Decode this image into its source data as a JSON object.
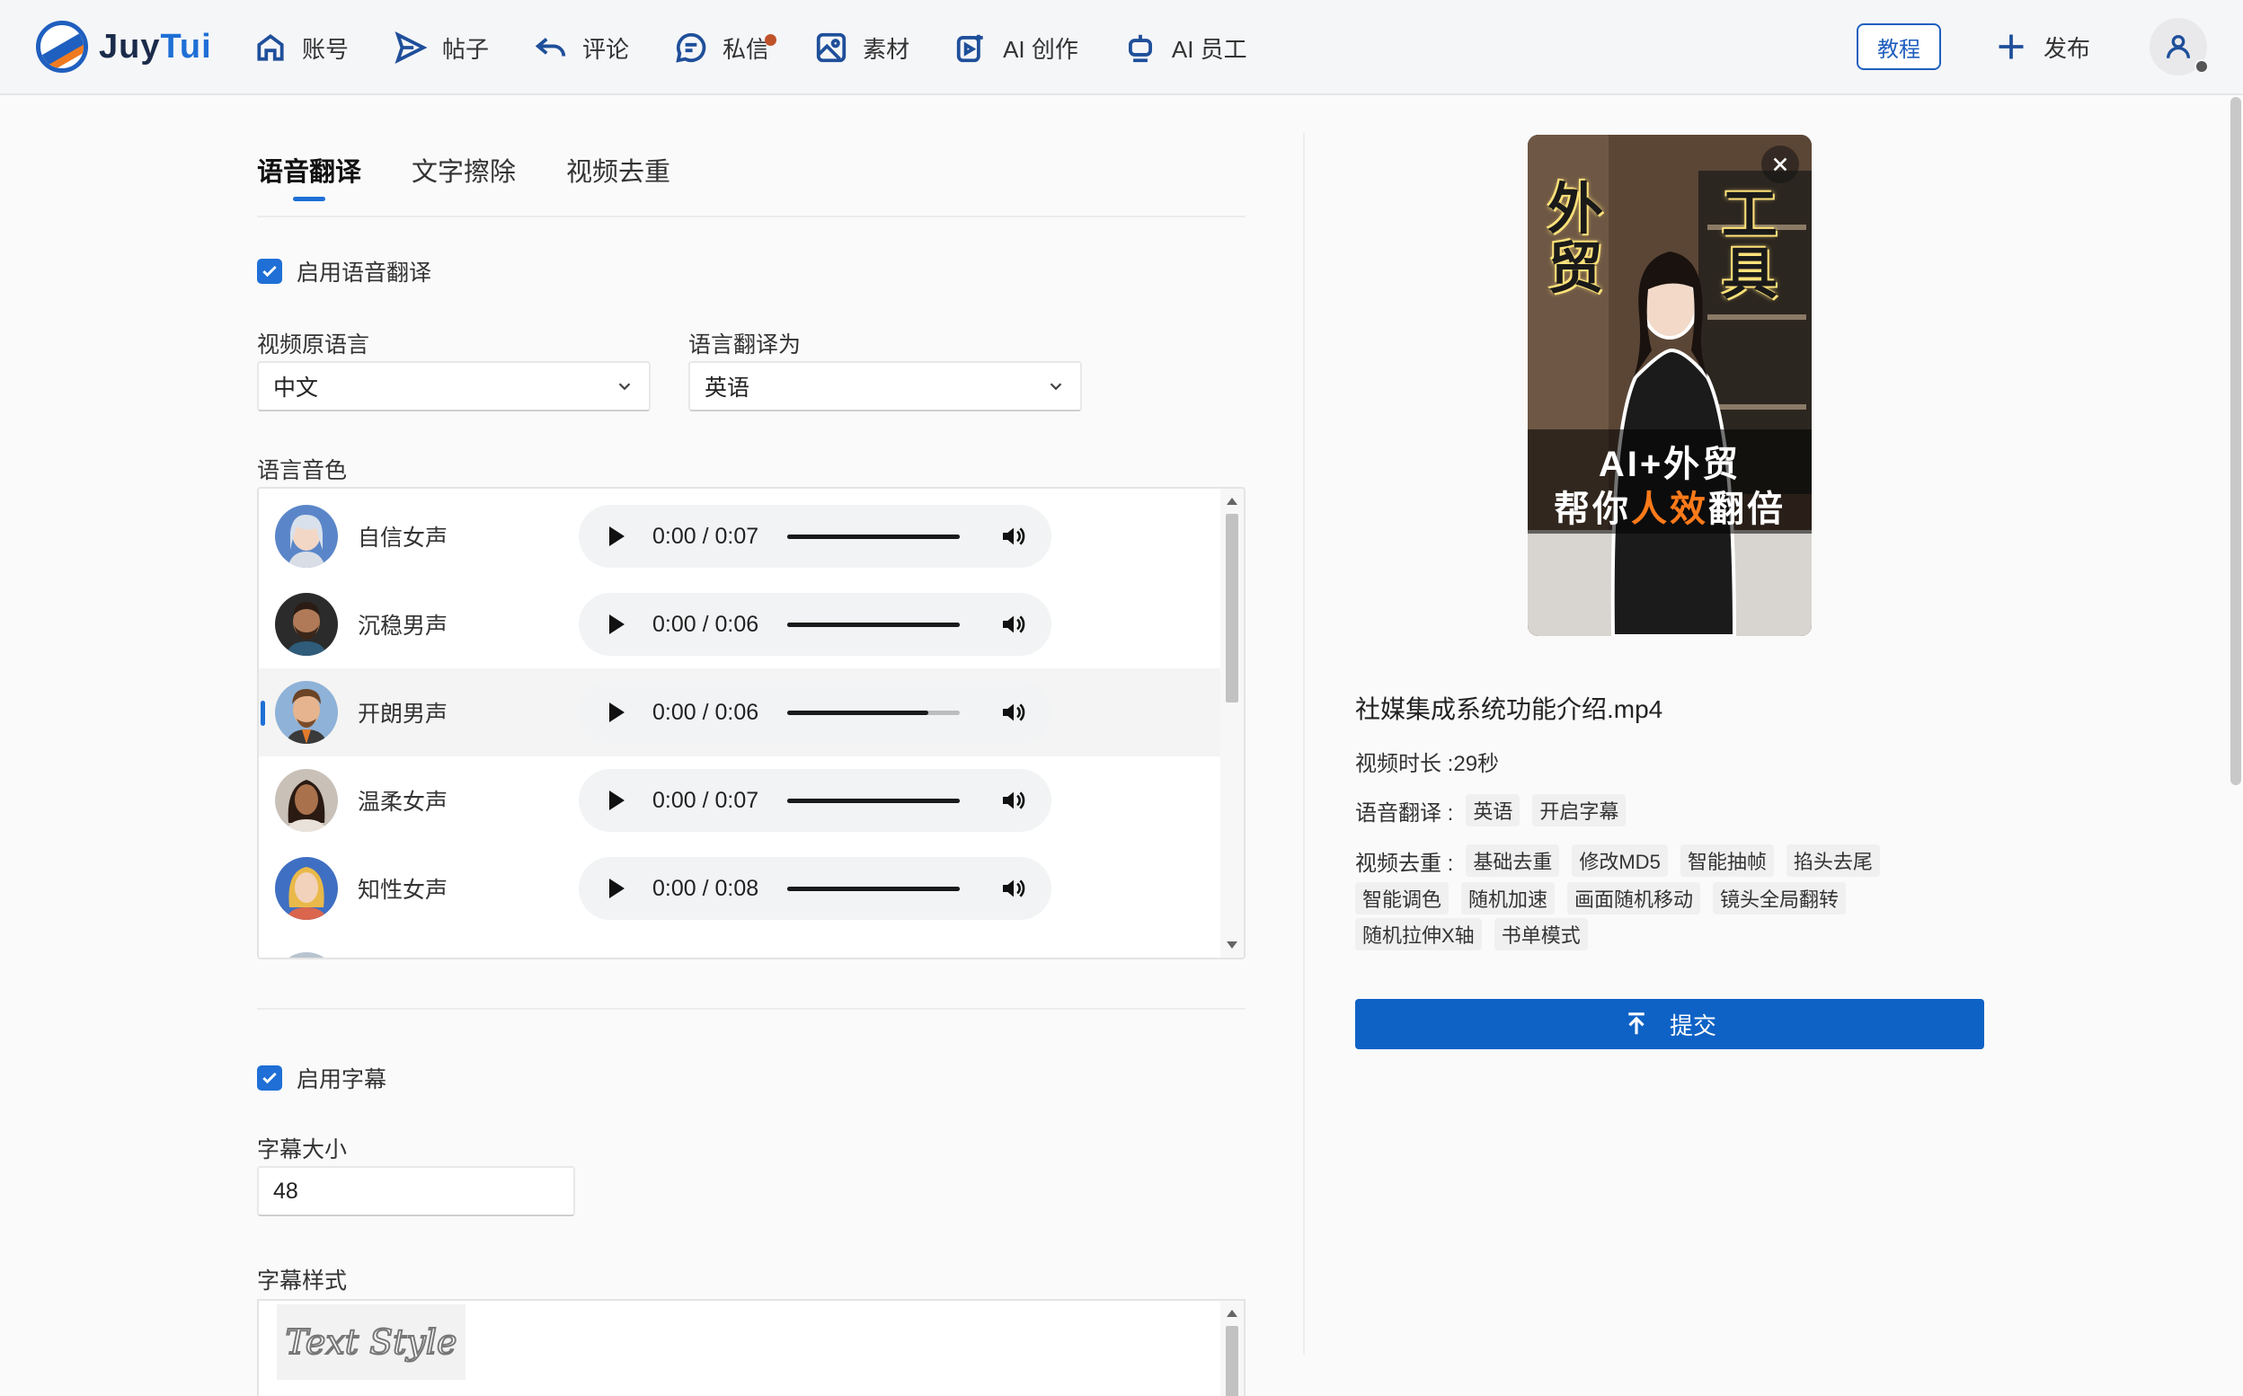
{
  "app": {
    "logo_primary": "Juy",
    "logo_accent": "Tui"
  },
  "nav": [
    {
      "label": "账号",
      "icon": "home-icon",
      "badge": false
    },
    {
      "label": "帖子",
      "icon": "send-icon",
      "badge": false
    },
    {
      "label": "评论",
      "icon": "reply-icon",
      "badge": false
    },
    {
      "label": "私信",
      "icon": "chat-icon",
      "badge": true
    },
    {
      "label": "素材",
      "icon": "image-icon",
      "badge": false
    },
    {
      "label": "AI 创作",
      "icon": "ai-create-icon",
      "badge": false
    },
    {
      "label": "AI 员工",
      "icon": "robot-icon",
      "badge": false
    }
  ],
  "header": {
    "tutorial": "教程",
    "publish": "发布"
  },
  "tabs": [
    {
      "label": "语音翻译",
      "active": true
    },
    {
      "label": "文字擦除",
      "active": false
    },
    {
      "label": "视频去重",
      "active": false
    }
  ],
  "translation": {
    "enable_label": "启用语音翻译",
    "enabled": true,
    "source_label": "视频原语言",
    "source_value": "中文",
    "target_label": "语言翻译为",
    "target_value": "英语",
    "voice_label": "语言音色",
    "voices": [
      {
        "name": "自信女声",
        "time": "0:00 / 0:07",
        "progress": 1.0,
        "selected": false
      },
      {
        "name": "沉稳男声",
        "time": "0:00 / 0:06",
        "progress": 1.0,
        "selected": false
      },
      {
        "name": "开朗男声",
        "time": "0:00 / 0:06",
        "progress": 0.82,
        "selected": true
      },
      {
        "name": "温柔女声",
        "time": "0:00 / 0:07",
        "progress": 1.0,
        "selected": false
      },
      {
        "name": "知性女声",
        "time": "0:00 / 0:08",
        "progress": 1.0,
        "selected": false
      }
    ]
  },
  "subtitle": {
    "enable_label": "启用字幕",
    "enabled": true,
    "size_label": "字幕大小",
    "size_value": "48",
    "style_label": "字幕样式",
    "style_sample": "Text Style"
  },
  "preview": {
    "caption_left": "外贸",
    "caption_right": "工具",
    "caption_line1": "AI+外贸",
    "caption_line2_a": "帮你",
    "caption_line2_hl": "人效",
    "caption_line2_b": "翻倍",
    "filename": "社媒集成系统功能介绍.mp4",
    "duration_label": "视频时长 :",
    "duration_value": "29秒",
    "translate_label": "语音翻译 :",
    "translate_tags": [
      "英语",
      "开启字幕"
    ],
    "dedup_label": "视频去重 :",
    "dedup_tags_row1": [
      "基础去重",
      "修改MD5",
      "智能抽帧",
      "掐头去尾"
    ],
    "dedup_tags_row2": [
      "智能调色",
      "随机加速",
      "画面随机移动",
      "镜头全局翻转"
    ],
    "dedup_tags_row3": [
      "随机拉伸X轴",
      "书单模式"
    ],
    "submit_label": "提交"
  },
  "colors": {
    "accent": "#1f6fd6",
    "submit": "#0f62c5",
    "badge": "#c0522a"
  }
}
